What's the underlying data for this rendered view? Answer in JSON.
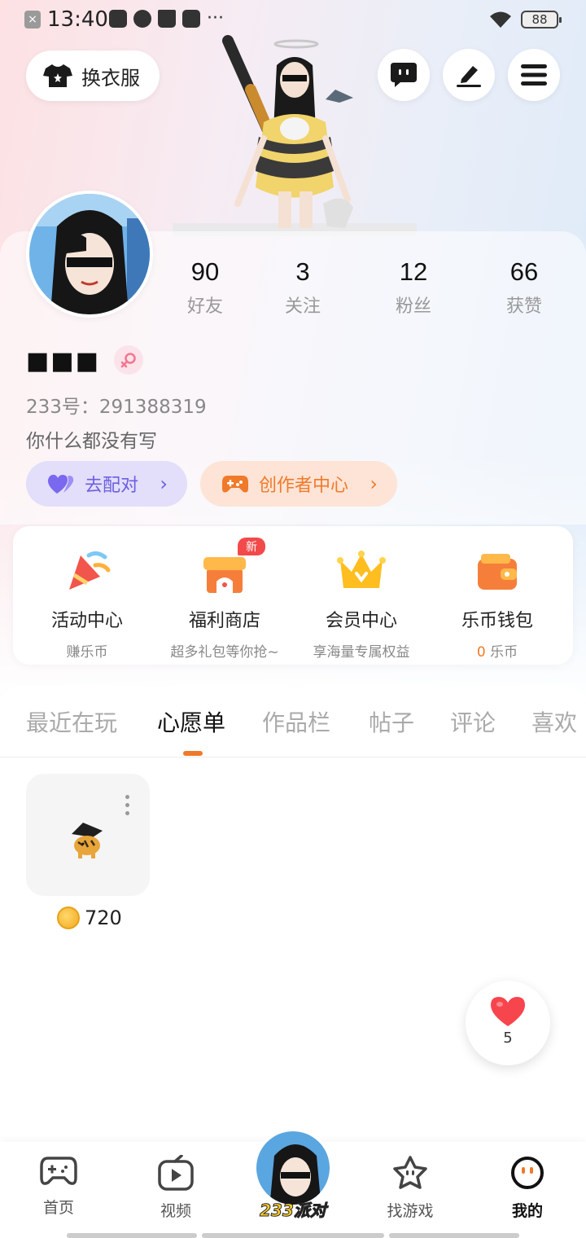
{
  "status_bar": {
    "time": "13:40",
    "battery": "88"
  },
  "header": {
    "outfit_label": "换衣服"
  },
  "profile": {
    "username": "■■■",
    "uid_label": "233号：",
    "uid": "291388319",
    "bio": "你什么都没有写",
    "stats": [
      {
        "value": "90",
        "label": "好友"
      },
      {
        "value": "3",
        "label": "关注"
      },
      {
        "value": "12",
        "label": "粉丝"
      },
      {
        "value": "66",
        "label": "获赞"
      }
    ],
    "match_label": "去配对",
    "creator_label": "创作者中心"
  },
  "functions": [
    {
      "title": "活动中心",
      "subtitle": "赚乐币"
    },
    {
      "title": "福利商店",
      "subtitle": "超多礼包等你抢~",
      "badge": "新"
    },
    {
      "title": "会员中心",
      "subtitle": "享海量专属权益"
    },
    {
      "title": "乐币钱包",
      "subtitle_num": "0",
      "subtitle": " 乐币"
    }
  ],
  "tabs": [
    "最近在玩",
    "心愿单",
    "作品栏",
    "帖子",
    "评论",
    "喜欢"
  ],
  "active_tab": "心愿单",
  "wishlist": [
    {
      "price": "720"
    }
  ],
  "like": {
    "count": "5"
  },
  "bottom_nav": {
    "items": [
      "首页",
      "视频",
      "找游戏",
      "我的"
    ],
    "center_label": "233派对"
  },
  "colors": {
    "accent": "#f07a2a",
    "match": "#6b5fe0",
    "badge": "#f24a4a"
  }
}
